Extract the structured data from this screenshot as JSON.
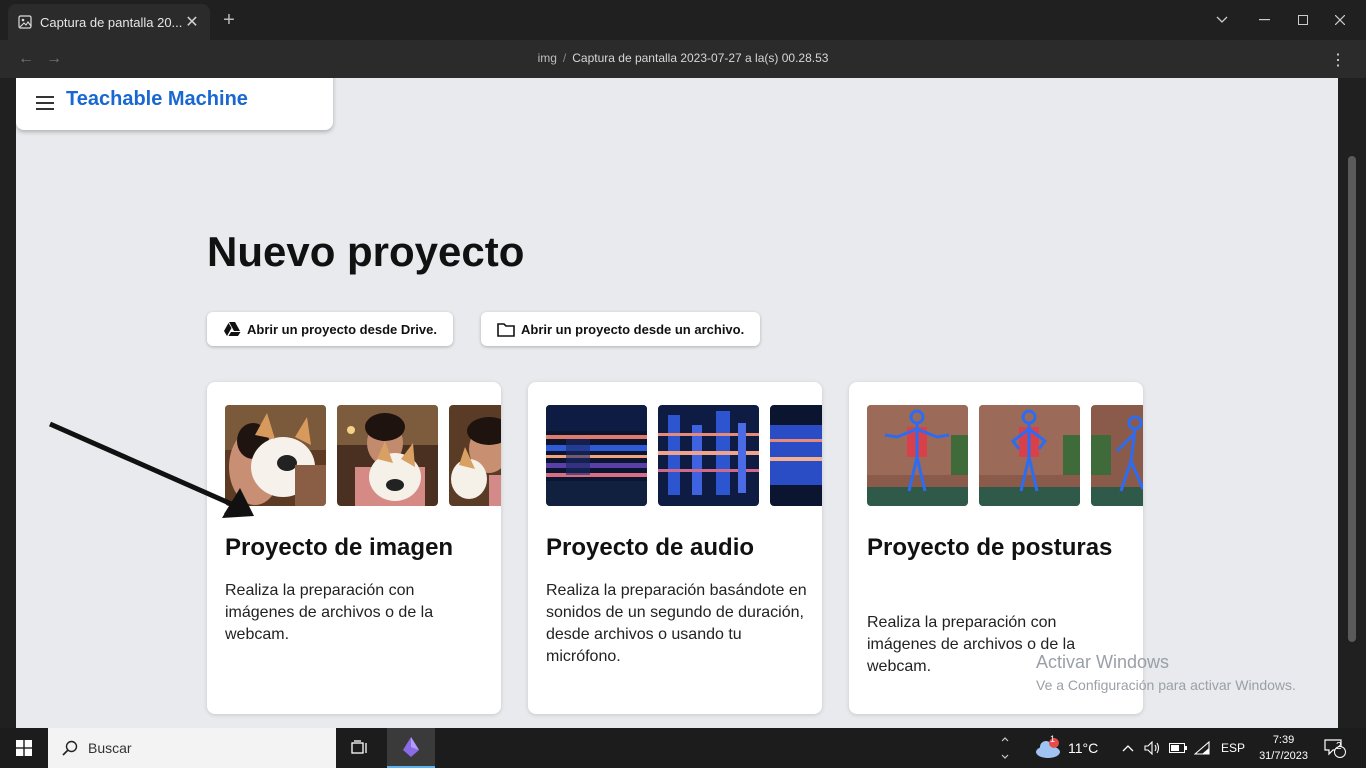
{
  "browser": {
    "tab_title": "Captura de pantalla 20...",
    "new_tab": "+",
    "breadcrumb_folder": "img",
    "breadcrumb_sep": "/",
    "breadcrumb_file": "Captura de pantalla 2023-07-27 a la(s) 00.28.53"
  },
  "app": {
    "brand": "Teachable Machine",
    "page_title": "Nuevo proyecto",
    "open_drive_label": "Abrir un proyecto desde Drive.",
    "open_file_label": "Abrir un proyecto desde un archivo.",
    "cards": [
      {
        "title": "Proyecto de imagen",
        "description": "Realiza la preparación con imágenes de archivos o de la webcam."
      },
      {
        "title": "Proyecto de audio",
        "description": "Realiza la preparación basándote en sonidos de un segundo de duración, desde archivos o usando tu micrófono."
      },
      {
        "title": "Proyecto de posturas",
        "description": "Realiza la preparación con imágenes de archivos o de la webcam."
      }
    ]
  },
  "watermark": {
    "line1": "Activar Windows",
    "line2": "Ve a Configuración para activar Windows."
  },
  "taskbar": {
    "search_label": "Buscar",
    "weather_badge": "1",
    "temperature": "11°C",
    "language": "ESP",
    "time": "7:39",
    "date": "31/7/2023",
    "notifications": "2"
  },
  "colors": {
    "brand_blue": "#1967d2",
    "page_bg": "#e8eaed"
  }
}
